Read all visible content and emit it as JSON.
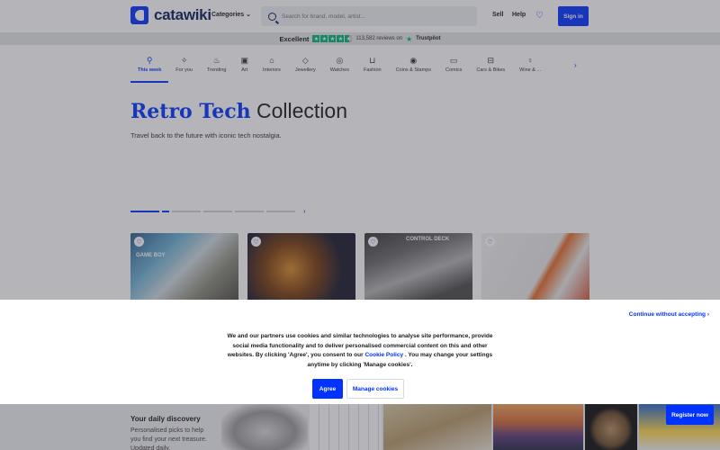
{
  "header": {
    "logo_text": "catawiki",
    "categories_label": "Categories",
    "search_placeholder": "Search for brand, model, artist...",
    "sell_label": "Sell",
    "help_label": "Help",
    "signin_label": "Sign in"
  },
  "trustbar": {
    "rating_word": "Excellent",
    "reviews_text": "113,582 reviews on",
    "provider": "Trustpilot",
    "stars": 4.5
  },
  "catnav": {
    "items": [
      {
        "label": "This week",
        "icon": "rocket-icon",
        "glyph": "⚲",
        "active": true
      },
      {
        "label": "For you",
        "icon": "sparkle-icon",
        "glyph": "✧",
        "active": false
      },
      {
        "label": "Trending",
        "icon": "flame-icon",
        "glyph": "♨",
        "active": false
      },
      {
        "label": "Art",
        "icon": "frame-icon",
        "glyph": "▣",
        "active": false
      },
      {
        "label": "Interiors",
        "icon": "sofa-icon",
        "glyph": "⌂",
        "active": false
      },
      {
        "label": "Jewellery",
        "icon": "diamond-icon",
        "glyph": "◇",
        "active": false
      },
      {
        "label": "Watches",
        "icon": "watch-icon",
        "glyph": "◎",
        "active": false
      },
      {
        "label": "Fashion",
        "icon": "bag-icon",
        "glyph": "⊔",
        "active": false
      },
      {
        "label": "Coins & Stamps",
        "icon": "coin-icon",
        "glyph": "◉",
        "active": false
      },
      {
        "label": "Comics",
        "icon": "speech-bubble-icon",
        "glyph": "▭",
        "active": false
      },
      {
        "label": "Cars & Bikes",
        "icon": "car-icon",
        "glyph": "⊟",
        "active": false
      },
      {
        "label": "Wine & ...",
        "icon": "wine-icon",
        "glyph": "♀",
        "active": false
      }
    ]
  },
  "hero": {
    "title_accent": "Retro Tech",
    "title_rest": " Collection",
    "subtitle": "Travel back to the future with iconic tech nostalgia."
  },
  "cards": [
    {
      "label": "GAME BOY"
    },
    {
      "label": ""
    },
    {
      "label": "CONTROL DECK"
    },
    {
      "label": ""
    }
  ],
  "discovery": {
    "title": "Your daily discovery",
    "subtitle": "Personalised picks to help you find your next treasure. Updated daily."
  },
  "cookie": {
    "continue_label": "Continue without accepting",
    "text_before": "We and our partners use cookies and similar technologies to analyse site performance, provide social media functionality and to deliver personalised commercial content on this and other websites. By clicking 'Agree', you consent to our ",
    "policy_link": "Cookie Policy",
    "text_after": " . You may change your settings anytime by clicking 'Manage cookies'.",
    "agree_label": "Agree",
    "manage_label": "Manage cookies"
  },
  "register_label": "Register now",
  "colors": {
    "accent": "#0033ff",
    "trustpilot": "#00b67a"
  }
}
